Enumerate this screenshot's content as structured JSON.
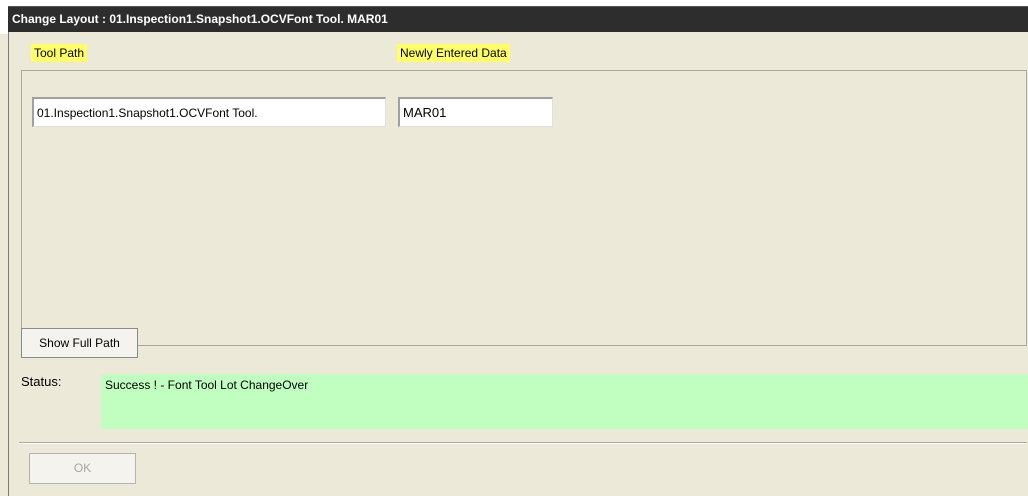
{
  "window": {
    "title": "Change Layout : 01.Inspection1.Snapshot1.OCVFont Tool. MAR01"
  },
  "columns": {
    "tool_path_label": "Tool Path",
    "new_data_label": "Newly Entered Data"
  },
  "rows": [
    {
      "tool_path": "01.Inspection1.Snapshot1.OCVFont Tool.",
      "new_data": "MAR01"
    }
  ],
  "buttons": {
    "show_full_path": "Show Full Path",
    "ok": "OK"
  },
  "status": {
    "label": "Status:",
    "message": "Success ! - Font Tool Lot ChangeOver",
    "color": "#c0ffc0"
  },
  "colors": {
    "label_highlight": "#ffff66",
    "titlebar": "#2d2d2d",
    "dialog_bg": "#ece9d8"
  }
}
